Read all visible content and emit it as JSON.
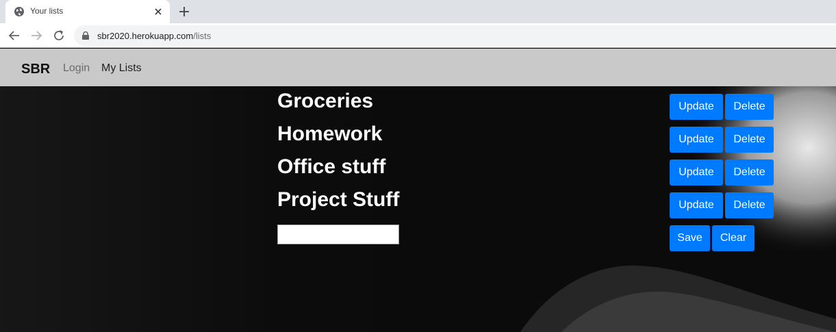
{
  "browser": {
    "tab_title": "Your lists",
    "url_host": "sbr2020.herokuapp.com",
    "url_path": "/lists"
  },
  "navbar": {
    "brand": "SBR",
    "login_label": "Login",
    "mylists_label": "My Lists"
  },
  "lists": [
    {
      "name": "Groceries",
      "update_label": "Update",
      "delete_label": "Delete"
    },
    {
      "name": "Homework",
      "update_label": "Update",
      "delete_label": "Delete"
    },
    {
      "name": "Office stuff",
      "update_label": "Update",
      "delete_label": "Delete"
    },
    {
      "name": "Project Stuff",
      "update_label": "Update",
      "delete_label": "Delete"
    }
  ],
  "new_list": {
    "value": "",
    "save_label": "Save",
    "clear_label": "Clear"
  },
  "colors": {
    "button_primary": "#007bff",
    "navbar_bg": "#c9c9c9"
  },
  "icons": {
    "favicon": "globe-icon",
    "tab_close": "close-icon",
    "new_tab": "plus-icon",
    "back": "arrow-left-icon",
    "forward": "arrow-right-icon",
    "reload": "reload-icon",
    "secure": "lock-icon"
  }
}
